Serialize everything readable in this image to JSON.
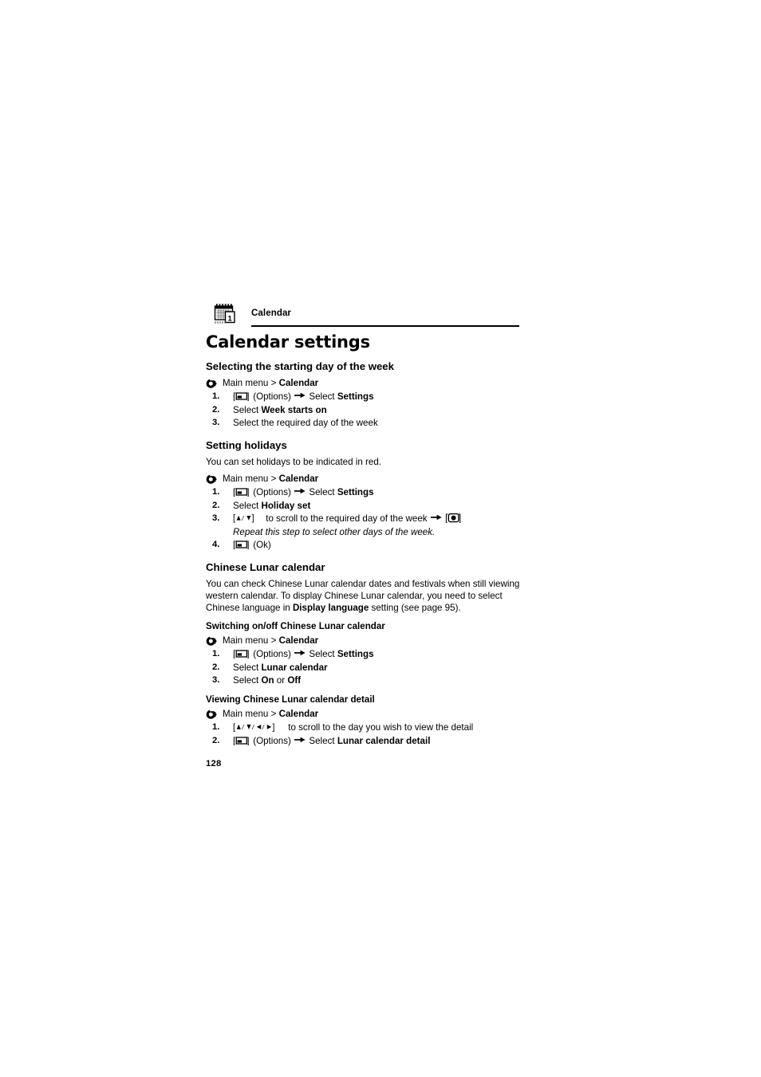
{
  "header": {
    "icon": "calendar-icon",
    "chapter_label": "Calendar"
  },
  "title": "Calendar settings",
  "folio": "128",
  "icons": {
    "path_bullet": "curved-arrow-bullet-icon",
    "softkey": "left-softkey-icon",
    "step_arrow": "right-arrow-icon",
    "ok_key": "center-ok-key-icon",
    "nav_up": "nav-up-icon",
    "nav_down": "nav-down-icon",
    "nav_left": "nav-left-icon",
    "nav_right": "nav-right-icon"
  },
  "sections": [
    {
      "heading": "Selecting the starting day of the week",
      "path_pre": "Main menu > ",
      "path_bold": "Calendar",
      "steps": [
        {
          "num": "1.",
          "pre": "",
          "mid": " (Options) ",
          "post": "Select ",
          "bold": "Settings",
          "tail": ""
        },
        {
          "num": "2.",
          "plain_pre": "Select ",
          "bold": "Week starts on",
          "tail": ""
        },
        {
          "num": "3.",
          "plain_pre": "Select the required day of the week",
          "bold": "",
          "tail": ""
        }
      ]
    },
    {
      "heading": "Setting holidays",
      "intro": "You can set holidays to be indicated in red.",
      "path_pre": "Main menu > ",
      "path_bold": "Calendar",
      "steps": [
        {
          "num": "1.",
          "mid": " (Options) ",
          "post": "Select ",
          "bold": "Settings"
        },
        {
          "num": "2.",
          "plain_pre": "Select ",
          "bold": "Holiday set"
        },
        {
          "num": "3.",
          "mid": " to scroll to the required day of the week "
        },
        {
          "num": "4.",
          "mid": " (Ok)"
        }
      ],
      "note": "Repeat this step to select other days of the week."
    },
    {
      "heading": "Chinese Lunar calendar",
      "intro_a": "You can check Chinese Lunar calendar dates and festivals when still viewing western calendar. To display Chinese Lunar calendar, you need to select Chinese language in ",
      "intro_bold": "Display language",
      "intro_b": " setting (see page 95).",
      "sub1": {
        "heading": "Switching on/off Chinese Lunar calendar",
        "path_pre": "Main menu > ",
        "path_bold": "Calendar",
        "steps": [
          {
            "num": "1.",
            "mid": " (Options) ",
            "post": "Select ",
            "bold": "Settings"
          },
          {
            "num": "2.",
            "plain_pre": "Select ",
            "bold": "Lunar calendar"
          },
          {
            "num": "3.",
            "plain_pre": "Select ",
            "bold": "On",
            "mid2": " or ",
            "bold2": "Off"
          }
        ]
      },
      "sub2": {
        "heading": "Viewing Chinese Lunar calendar detail",
        "path_pre": "Main menu > ",
        "path_bold": "Calendar",
        "steps": [
          {
            "num": "1.",
            "mid": " to scroll to the day you wish to view the detail"
          },
          {
            "num": "2.",
            "mid": " (Options) ",
            "post": "Select ",
            "bold": "Lunar calendar detail"
          }
        ]
      }
    }
  ]
}
